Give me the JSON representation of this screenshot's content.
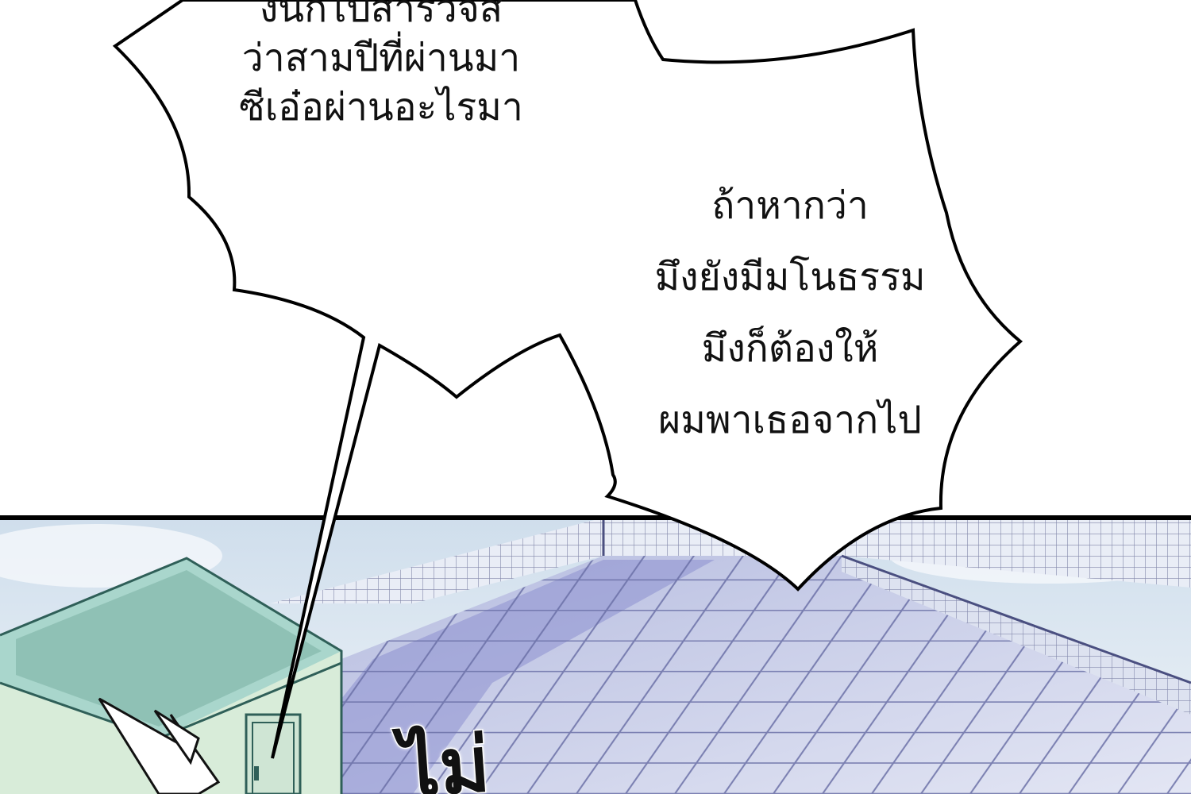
{
  "bubbles": {
    "left": {
      "lines": [
        "งนักไปสำรวจสิ",
        "ว่าสามปีที่ผ่านมา",
        "ซีเอ๋อผ่านอะไรมา"
      ]
    },
    "right": {
      "lines": [
        "ถ้าหากว่า",
        "มึงยังมีมโนธรรม",
        "มึงก็ต้องให้",
        "ผมพาเธอจากไป"
      ]
    }
  },
  "sfx": {
    "text": "ไม่"
  },
  "colors": {
    "panel_border": "#000000",
    "sky": "#dfe9f2",
    "rooftop": "#c9cfe6",
    "rooftop_shadow": "#8d8fcf",
    "grid_line": "#4a4f80",
    "building_wall": "#d8ecd9",
    "building_trim": "#6fa89c"
  }
}
